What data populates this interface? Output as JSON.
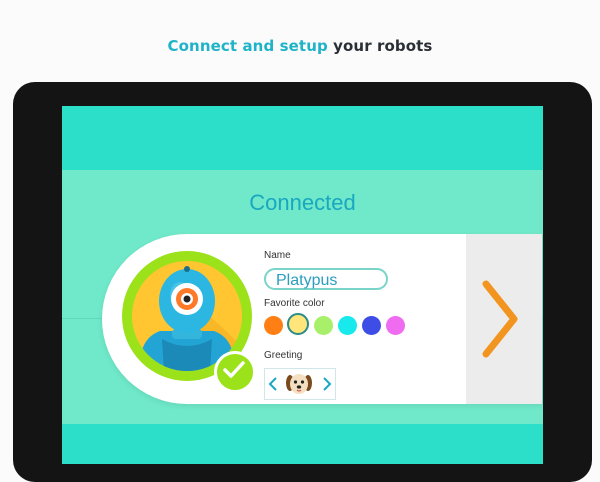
{
  "headline": {
    "accent": "Connect and setup",
    "rest": "your robots"
  },
  "screen": {
    "status": "Connected",
    "robot": {
      "name_label": "Name",
      "name_value": "Platypus",
      "color_label": "Favorite color",
      "colors": [
        "#ff7f14",
        "#ffe57a",
        "#a8f06a",
        "#18e9ec",
        "#3d4de6",
        "#ef6cf1"
      ],
      "selected_color_index": 1,
      "greeting_label": "Greeting",
      "greeting_icon": "dog-face-icon",
      "connected_icon": "checkmark-icon",
      "next_icon": "chevron-right-icon"
    }
  },
  "colors": {
    "accent_text": "#1fb3c9",
    "top_bar": "#2bdfc8",
    "background": "#6fe9c9",
    "avatar_ring": "#9be21a",
    "next_chevron": "#f29520"
  }
}
